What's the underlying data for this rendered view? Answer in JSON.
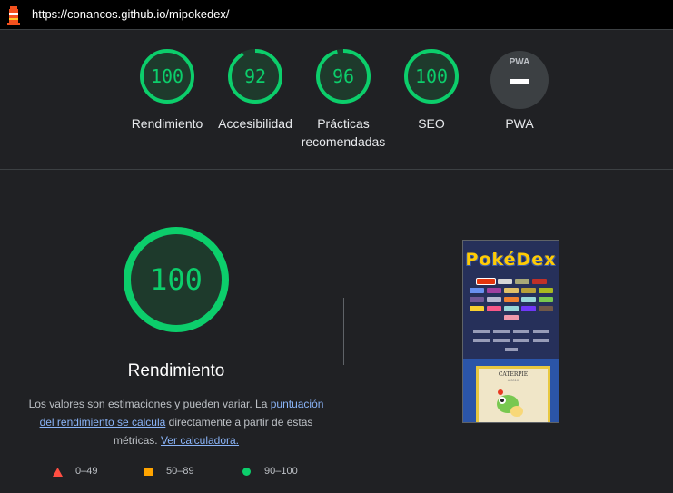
{
  "url": "https://conancos.github.io/mipokedex/",
  "colors": {
    "pass": "#0cce6b",
    "average": "#ffa400",
    "fail": "#ff4e42",
    "neutral": "#5f6368"
  },
  "categories": [
    {
      "score": "100",
      "label": "Rendimiento",
      "value": 100
    },
    {
      "score": "92",
      "label": "Accesibilidad",
      "value": 92
    },
    {
      "score": "96",
      "label_line1": "Prácticas",
      "label_line2": "recomendadas",
      "value": 96
    },
    {
      "score": "100",
      "label": "SEO",
      "value": 100
    },
    {
      "badge": "PWA",
      "label": "PWA"
    }
  ],
  "main": {
    "score": "100",
    "value": 100,
    "title": "Rendimiento",
    "desc_text1": "Los valores son estimaciones y pueden variar. La ",
    "desc_link1": "puntuación del rendimiento se calcula",
    "desc_text2": " directamente a partir de estas métricas. ",
    "desc_link2": "Ver calculadora."
  },
  "legend": {
    "fail": "0–49",
    "average": "50–89",
    "pass": "90–100"
  },
  "screenshot": {
    "logo": "PokéDex",
    "card_name": "CATERPIE",
    "card_num": "# 0010"
  }
}
